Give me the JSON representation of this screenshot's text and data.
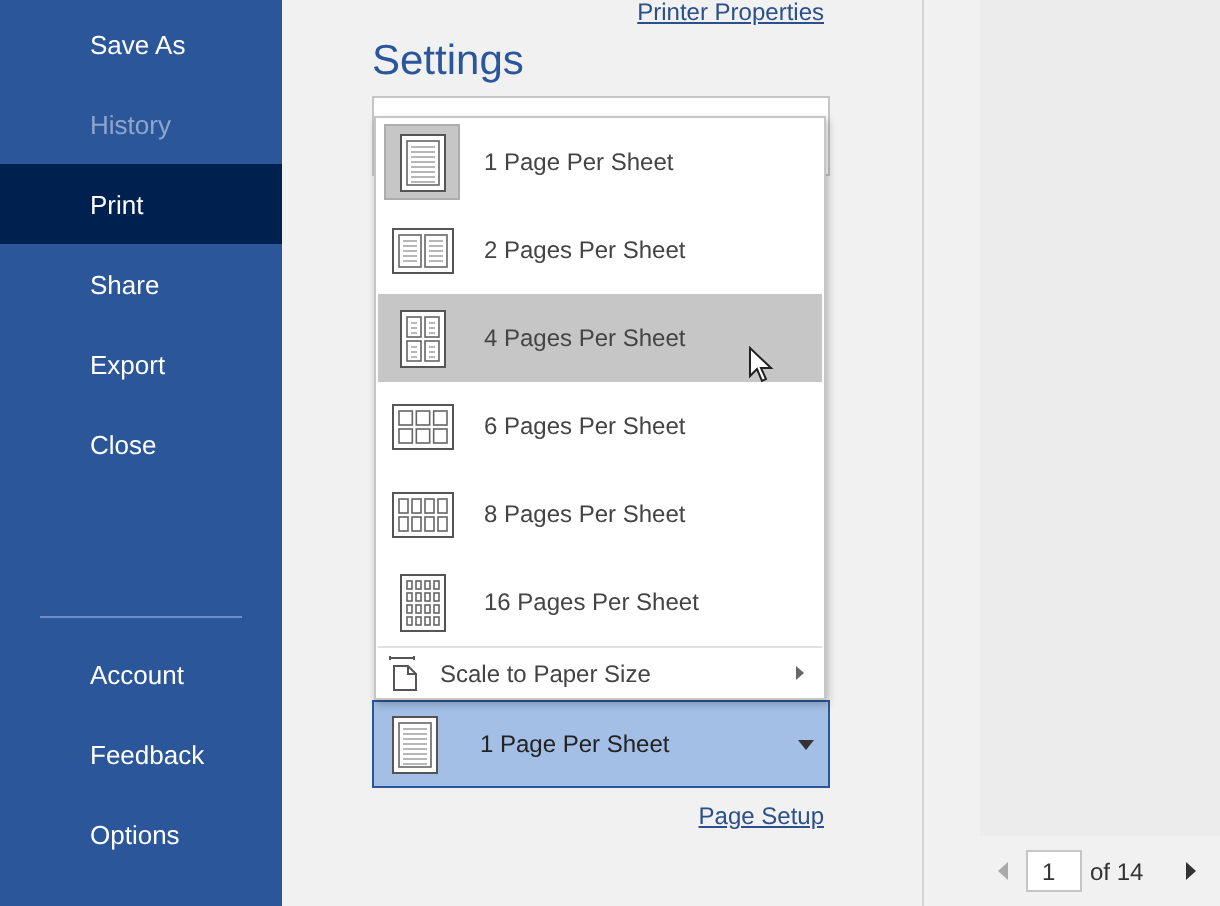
{
  "sidebar": {
    "items": [
      {
        "label": "Save As",
        "selected": false,
        "disabled": false
      },
      {
        "label": "History",
        "selected": false,
        "disabled": true
      },
      {
        "label": "Print",
        "selected": true,
        "disabled": false
      },
      {
        "label": "Share",
        "selected": false,
        "disabled": false
      },
      {
        "label": "Export",
        "selected": false,
        "disabled": false
      },
      {
        "label": "Close",
        "selected": false,
        "disabled": false
      }
    ],
    "bottom_items": [
      {
        "label": "Account",
        "selected": false,
        "disabled": false
      },
      {
        "label": "Feedback",
        "selected": false,
        "disabled": false
      },
      {
        "label": "Options",
        "selected": false,
        "disabled": false
      }
    ]
  },
  "printer_properties_link": "Printer Properties",
  "settings": {
    "title": "Settings",
    "pages_menu": {
      "options": [
        {
          "label": "1 Page Per Sheet",
          "kind": "one",
          "selected": true,
          "hovered": false
        },
        {
          "label": "2 Pages Per Sheet",
          "kind": "two",
          "selected": false,
          "hovered": false
        },
        {
          "label": "4 Pages Per Sheet",
          "kind": "four",
          "selected": false,
          "hovered": true
        },
        {
          "label": "6 Pages Per Sheet",
          "kind": "six",
          "selected": false,
          "hovered": false
        },
        {
          "label": "8 Pages Per Sheet",
          "kind": "eight",
          "selected": false,
          "hovered": false
        },
        {
          "label": "16 Pages Per Sheet",
          "kind": "sixteen",
          "selected": false,
          "hovered": false
        }
      ],
      "scale_item": {
        "label": "Scale to Paper Size",
        "has_submenu": true
      }
    },
    "pages_per_sheet": {
      "value": "1 Page Per Sheet",
      "kind": "one"
    },
    "page_setup_link": "Page Setup"
  },
  "preview": {
    "page": "1",
    "of_pages": "of 14",
    "prev_disabled": true
  }
}
